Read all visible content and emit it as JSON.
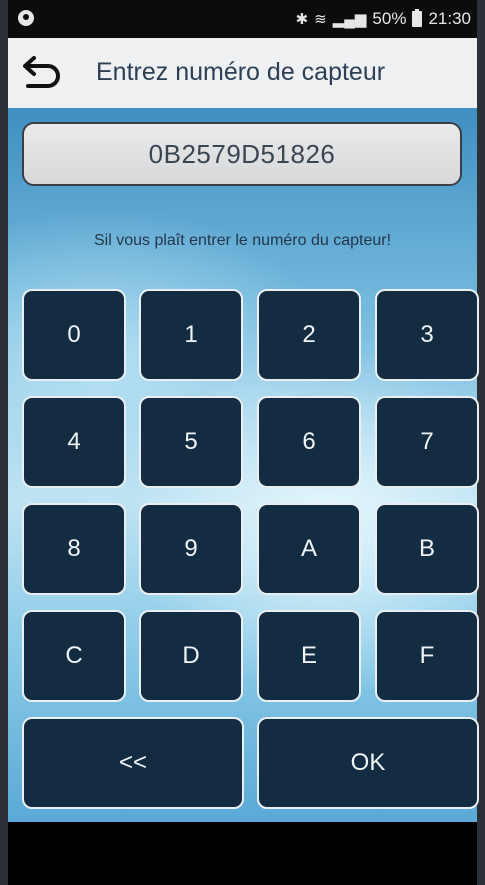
{
  "status_bar": {
    "battery": "50%",
    "time": "21:30",
    "icons": [
      "bluetooth-icon",
      "wifi-icon",
      "signal-icon",
      "battery-icon"
    ]
  },
  "header": {
    "title": "Entrez numéro de capteur",
    "back_icon": "back-arrow-icon"
  },
  "display": {
    "value": "0B2579D51826"
  },
  "hint": "Sil vous plaît entrer le numéro du capteur!",
  "keypad": {
    "rows": [
      [
        "0",
        "1",
        "2",
        "3"
      ],
      [
        "4",
        "5",
        "6",
        "7"
      ],
      [
        "8",
        "9",
        "A",
        "B"
      ],
      [
        "C",
        "D",
        "E",
        "F"
      ]
    ],
    "backspace": "<<",
    "ok": "OK"
  },
  "colors": {
    "key_bg": "#132c41",
    "key_border": "#e8eef2",
    "header_bg": "#eef0f2",
    "title_text": "#2d4054"
  }
}
